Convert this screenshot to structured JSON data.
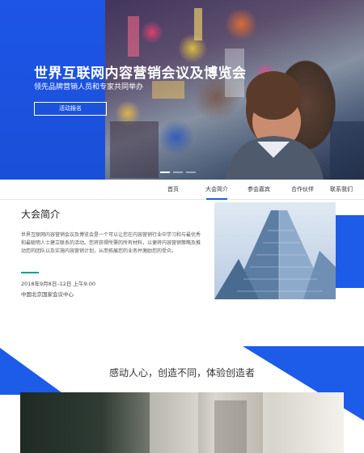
{
  "hero": {
    "title": "世界互联网内容营销会议及博览会",
    "subtitle": "领先品牌营销人员和专家共同举办",
    "signup_label": "活动报名",
    "slides_total": 3,
    "slides_active": 1
  },
  "nav": {
    "items": [
      {
        "label": "首页"
      },
      {
        "label": "大会简介"
      },
      {
        "label": "参会嘉宾"
      },
      {
        "label": "合作伙伴"
      },
      {
        "label": "联系我们"
      }
    ],
    "active_index": 1
  },
  "intro": {
    "title": "大会简介",
    "body": "世界互联网内容营销会议及博览会是一个可以让您在内容营销行业中学习和与最优秀和最聪明人士建立联系的活动。您将获得所需的所有材料，以便将内容营销策略及推动您的团队以及实施内容营销计划，从而拓展您的业务并激励您的受众。",
    "date": "2018年9月8日–12日 上午9:00",
    "location": "中国北京国家会议中心"
  },
  "section2": {
    "slogan": "感动人心，创造不同，体验创造者"
  },
  "colors": {
    "accent": "#1d5ce8",
    "teal": "#1d9e8a"
  }
}
